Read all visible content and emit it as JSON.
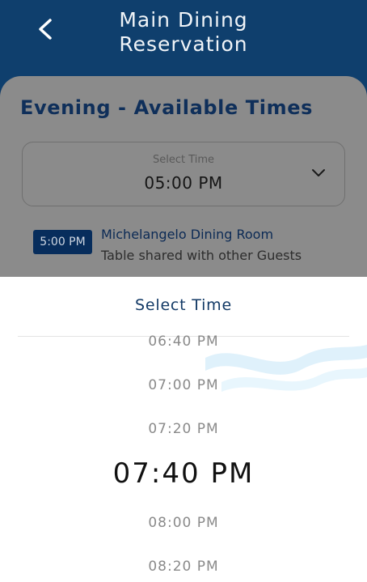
{
  "header": {
    "title_line1": "Main Dining",
    "title_line2": "Reservation"
  },
  "main": {
    "section_title": "Evening - Available Times",
    "select": {
      "label": "Select Time",
      "value": "05:00 PM"
    },
    "slot": {
      "time_badge": "5:00 PM",
      "room_name": "Michelangelo Dining Room",
      "note": "Table shared with other Guests"
    }
  },
  "picker": {
    "title": "Select Time",
    "options": [
      "06:40 PM",
      "07:00 PM",
      "07:20 PM",
      "07:40 PM",
      "08:00 PM",
      "08:20 PM"
    ],
    "selected": "07:40 PM"
  },
  "colors": {
    "header_bg": "#0f3f6d",
    "accent_navy": "#072d5c",
    "dim_overlay": "#8b8b8b",
    "sheet_bg": "#ffffff"
  },
  "icons": {
    "back": "chevron-left-icon",
    "dropdown": "chevron-down-icon",
    "decor": "wave-decoration-icon"
  }
}
